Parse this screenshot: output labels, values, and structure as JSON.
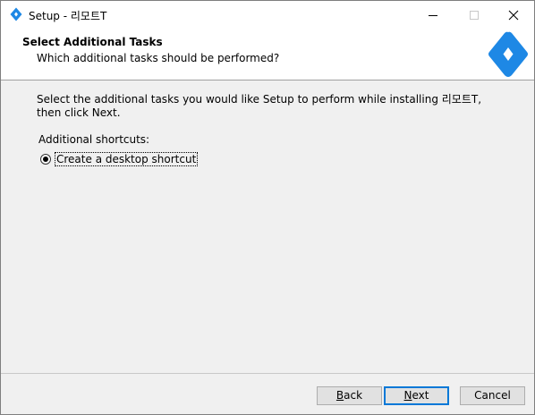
{
  "window": {
    "title": "Setup - 리모트T",
    "icon": "app-diamond-icon",
    "accent_color": "#1e88e5"
  },
  "header": {
    "title": "Select Additional Tasks",
    "subtitle": "Which additional tasks should be performed?",
    "logo": "app-diamond-logo"
  },
  "body": {
    "intro": "Select the additional tasks you would like Setup to perform while installing 리모트T, then click Next.",
    "group_label": "Additional shortcuts:",
    "options": [
      {
        "label": "Create a desktop shortcut",
        "selected": true
      }
    ]
  },
  "buttons": {
    "back": {
      "accel": "B",
      "rest": "ack"
    },
    "next": {
      "accel": "N",
      "rest": "ext"
    },
    "cancel": "Cancel"
  }
}
